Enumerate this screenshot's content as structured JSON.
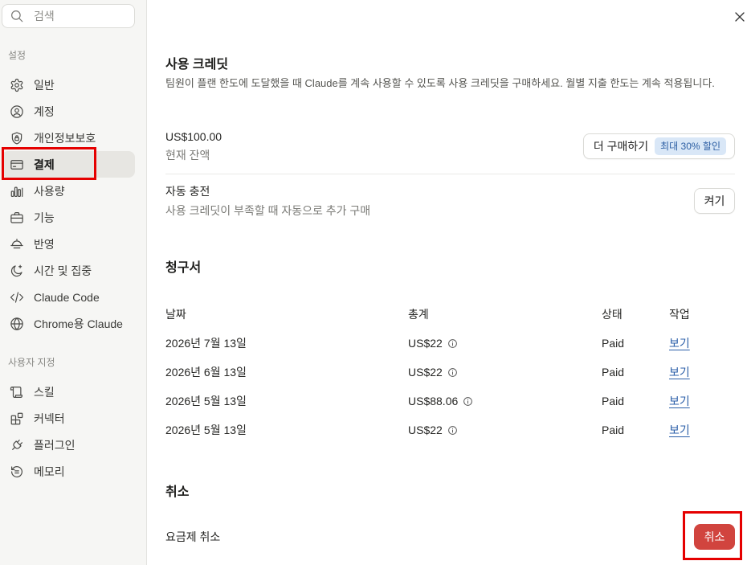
{
  "search": {
    "placeholder": "검색",
    "icon": "search-icon"
  },
  "window": {
    "close_icon": "close-icon"
  },
  "sidebar": {
    "sections": [
      {
        "label": "설정",
        "items": [
          {
            "label": "일반",
            "icon": "gear-icon"
          },
          {
            "label": "계정",
            "icon": "user-circle-icon"
          },
          {
            "label": "개인정보보호",
            "icon": "shield-lock-icon"
          },
          {
            "label": "결제",
            "icon": "credit-card-icon",
            "active": true
          },
          {
            "label": "사용량",
            "icon": "bar-chart-icon"
          },
          {
            "label": "기능",
            "icon": "briefcase-icon"
          },
          {
            "label": "반영",
            "icon": "dome-icon"
          },
          {
            "label": "시간 및 집중",
            "icon": "moon-icon"
          },
          {
            "label": "Claude Code",
            "icon": "code-icon"
          },
          {
            "label": "Chrome용 Claude",
            "icon": "globe-icon"
          }
        ]
      },
      {
        "label": "사용자 지정",
        "items": [
          {
            "label": "스킬",
            "icon": "scroll-icon"
          },
          {
            "label": "커넥터",
            "icon": "blocks-icon"
          },
          {
            "label": "플러그인",
            "icon": "plug-icon"
          },
          {
            "label": "메모리",
            "icon": "memory-icon"
          }
        ]
      }
    ]
  },
  "credits": {
    "title": "사용 크레딧",
    "description": "팀원이 플랜 한도에 도달했을 때 Claude를 계속 사용할 수 있도록 사용 크레딧을 구매하세요. 월별 지출 한도는 계속 적용됩니다.",
    "balance": {
      "amount": "US$100.00",
      "label": "현재 잔액"
    },
    "buy_button": {
      "label": "더 구매하기",
      "badge": "최대 30% 할인"
    },
    "auto_recharge": {
      "title": "자동 충전",
      "description": "사용 크레딧이 부족할 때 자동으로 추가 구매",
      "button_label": "켜기"
    }
  },
  "invoices": {
    "title": "청구서",
    "columns": {
      "date": "날짜",
      "total": "총계",
      "status": "상태",
      "action": "작업"
    },
    "total_icon": "info-icon",
    "rows": [
      {
        "date": "2026년 7월 13일",
        "total": "US$22",
        "status": "Paid",
        "action": "보기"
      },
      {
        "date": "2026년 6월 13일",
        "total": "US$22",
        "status": "Paid",
        "action": "보기"
      },
      {
        "date": "2026년 5월 13일",
        "total": "US$88.06",
        "status": "Paid",
        "action": "보기"
      },
      {
        "date": "2026년 5월 13일",
        "total": "US$22",
        "status": "Paid",
        "action": "보기"
      }
    ]
  },
  "cancel": {
    "title": "취소",
    "label": "요금제 취소",
    "button_label": "취소"
  },
  "colors": {
    "sidebar_bg": "#f6f6f4",
    "selected_bg": "#e7e6e2",
    "link": "#2a5ea8",
    "danger": "#d1443e",
    "badge_bg": "#d9e7f7",
    "badge_text": "#2c5ea3",
    "annotation": "#e50000"
  }
}
